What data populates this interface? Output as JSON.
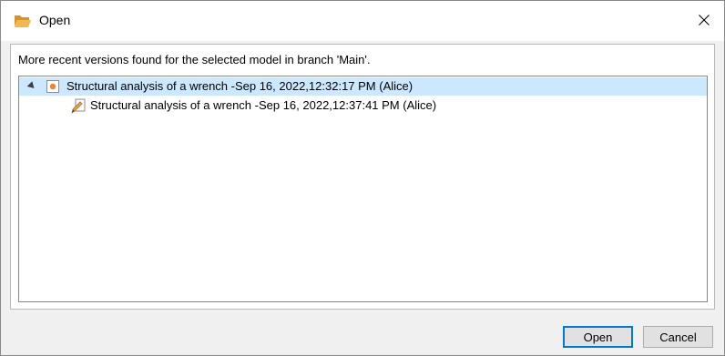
{
  "window": {
    "title": "Open",
    "title_icon": "folder-open-icon",
    "close_icon": "close-icon"
  },
  "message": "More recent versions found for the selected model in branch 'Main'.",
  "tree": {
    "items": [
      {
        "label": "Structural analysis of a wrench -Sep 16, 2022,12:32:17 PM (Alice)",
        "icon": "model-icon",
        "expanded": true,
        "selected": true,
        "level": 0
      },
      {
        "label": "Structural analysis of a wrench -Sep 16, 2022,12:37:41 PM (Alice)",
        "icon": "edit-version-icon",
        "expanded": false,
        "selected": false,
        "level": 1
      }
    ]
  },
  "buttons": {
    "open_label": "Open",
    "cancel_label": "Cancel"
  },
  "colors": {
    "selection": "#cce8ff",
    "accent": "#0078d7",
    "folder": "#e8a33d"
  }
}
